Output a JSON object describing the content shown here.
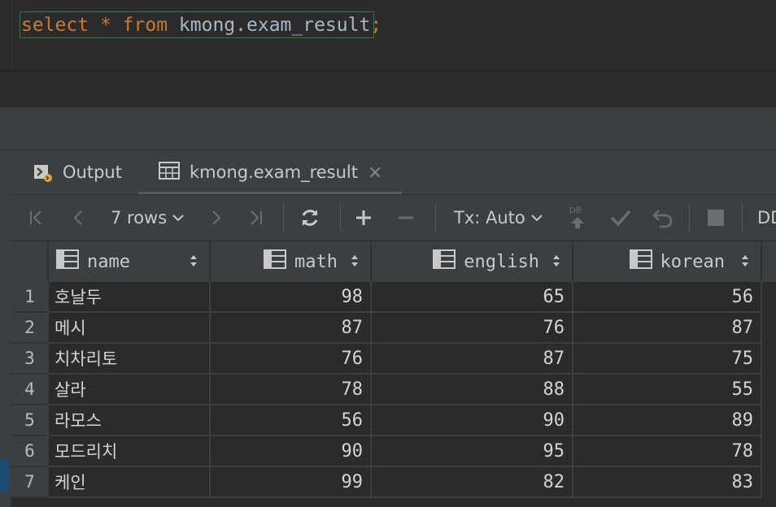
{
  "editor": {
    "query": {
      "kw1": "select",
      "star": "*",
      "kw2": "from",
      "table": "kmong.exam_result",
      "semicolon": ";"
    }
  },
  "tabs": [
    {
      "label": "Output"
    },
    {
      "label": "kmong.exam_result",
      "close": "×"
    }
  ],
  "toolbar": {
    "rows": "7 rows",
    "tx": "Tx: Auto",
    "db_badge": "DB",
    "dd": "DD"
  },
  "table": {
    "columns": [
      "name",
      "math",
      "english",
      "korean"
    ],
    "rows": [
      {
        "n": "1",
        "name": "호날두",
        "math": "98",
        "english": "65",
        "korean": "56"
      },
      {
        "n": "2",
        "name": "메시",
        "math": "87",
        "english": "76",
        "korean": "87"
      },
      {
        "n": "3",
        "name": "치차리토",
        "math": "76",
        "english": "87",
        "korean": "75"
      },
      {
        "n": "4",
        "name": "살라",
        "math": "78",
        "english": "88",
        "korean": "55"
      },
      {
        "n": "5",
        "name": "라모스",
        "math": "56",
        "english": "90",
        "korean": "89"
      },
      {
        "n": "6",
        "name": "모드리치",
        "math": "90",
        "english": "95",
        "korean": "78"
      },
      {
        "n": "7",
        "name": "케인",
        "math": "99",
        "english": "82",
        "korean": "83"
      }
    ]
  },
  "colors": {
    "keyword": "#cc7832",
    "identifier": "#a9b7c6",
    "panel": "#3c3f41",
    "editor_bg": "#2b2b2b",
    "selection_border": "#2e7d32"
  }
}
